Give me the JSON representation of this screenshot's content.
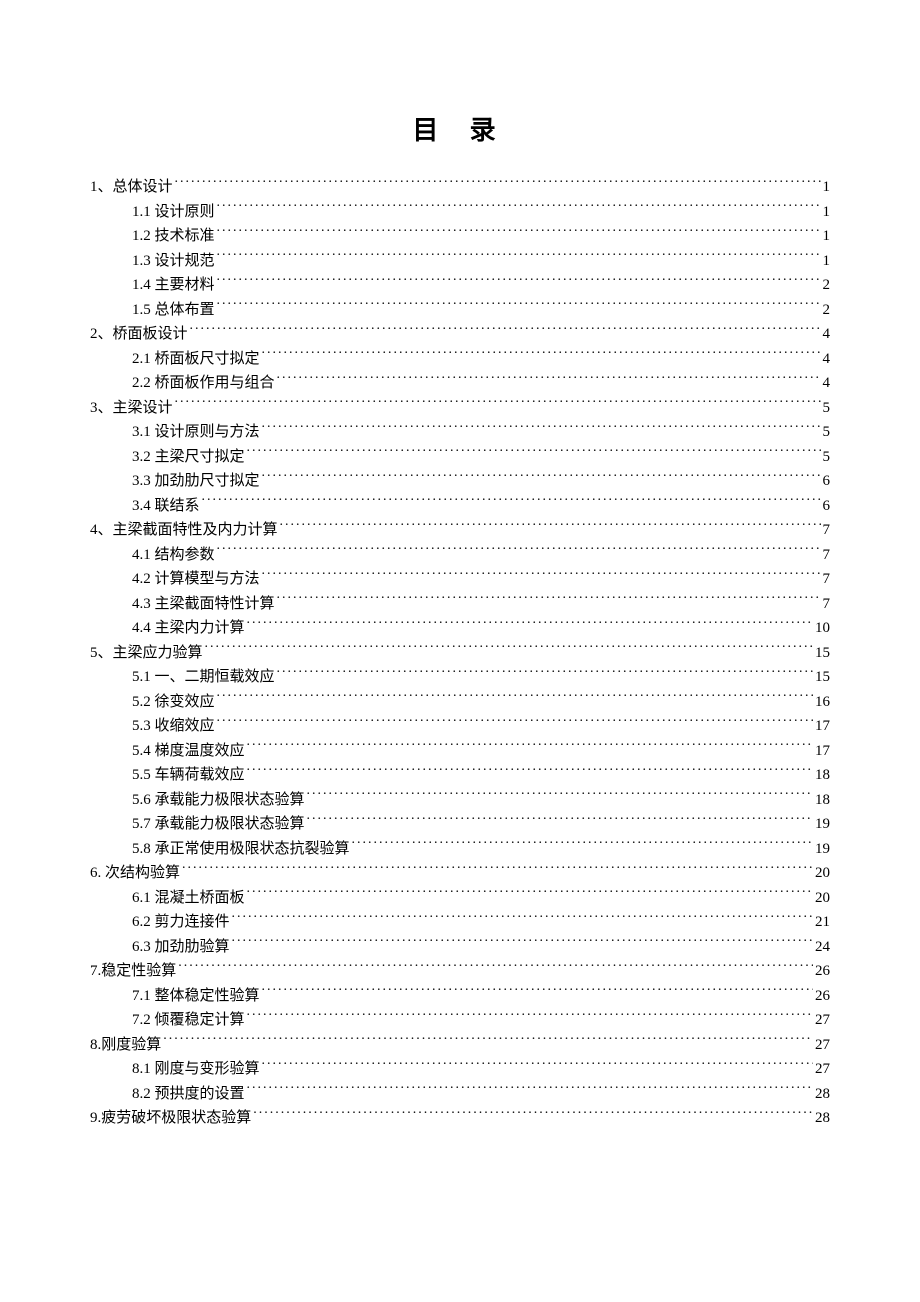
{
  "title": "目 录",
  "toc": [
    {
      "level": 1,
      "label": "1、总体设计",
      "page": "1"
    },
    {
      "level": 2,
      "label": "1.1 设计原则",
      "page": "1"
    },
    {
      "level": 2,
      "label": "1.2 技术标准",
      "page": "1"
    },
    {
      "level": 2,
      "label": "1.3  设计规范",
      "page": "1"
    },
    {
      "level": 2,
      "label": "1.4 主要材料",
      "page": "2"
    },
    {
      "level": 2,
      "label": "1.5 总体布置",
      "page": "2"
    },
    {
      "level": 1,
      "label": "2、桥面板设计",
      "page": "4"
    },
    {
      "level": 2,
      "label": "2.1 桥面板尺寸拟定",
      "page": "4"
    },
    {
      "level": 2,
      "label": "2.2 桥面板作用与组合",
      "page": "4"
    },
    {
      "level": 1,
      "label": "3、主梁设计",
      "page": "5"
    },
    {
      "level": 2,
      "label": "3.1 设计原则与方法",
      "page": "5"
    },
    {
      "level": 2,
      "label": "3.2 主梁尺寸拟定",
      "page": "5"
    },
    {
      "level": 2,
      "label": "3.3 加劲肋尺寸拟定",
      "page": "6"
    },
    {
      "level": 2,
      "label": "3.4 联结系",
      "page": "6"
    },
    {
      "level": 1,
      "label": "4、主梁截面特性及内力计算",
      "page": "7"
    },
    {
      "level": 2,
      "label": "4.1 结构参数",
      "page": "7"
    },
    {
      "level": 2,
      "label": "4.2 计算模型与方法",
      "page": "7"
    },
    {
      "level": 2,
      "label": "4.3 主梁截面特性计算",
      "page": "7"
    },
    {
      "level": 2,
      "label": "4.4 主梁内力计算",
      "page": "10"
    },
    {
      "level": 1,
      "label": "5、主梁应力验算",
      "page": "15"
    },
    {
      "level": 2,
      "label": "5.1 一、二期恒载效应",
      "page": "15"
    },
    {
      "level": 2,
      "label": "5.2 徐变效应",
      "page": "16"
    },
    {
      "level": 2,
      "label": "5.3 收缩效应",
      "page": "17"
    },
    {
      "level": 2,
      "label": "5.4 梯度温度效应",
      "page": "17"
    },
    {
      "level": 2,
      "label": "5.5 车辆荷载效应",
      "page": "18"
    },
    {
      "level": 2,
      "label": "5.6 承载能力极限状态验算",
      "page": "18"
    },
    {
      "level": 2,
      "label": "5.7 承载能力极限状态验算",
      "page": "19"
    },
    {
      "level": 2,
      "label": "5.8 承正常使用极限状态抗裂验算",
      "page": "19"
    },
    {
      "level": 1,
      "label": "6.  次结构验算",
      "page": "20"
    },
    {
      "level": 2,
      "label": "6.1 混凝土桥面板",
      "page": "20"
    },
    {
      "level": 2,
      "label": "6.2 剪力连接件",
      "page": "21"
    },
    {
      "level": 2,
      "label": "6.3 加劲肋验算",
      "page": "24"
    },
    {
      "level": 1,
      "label": "7.稳定性验算",
      "page": "26"
    },
    {
      "level": 2,
      "label": "7.1 整体稳定性验算",
      "page": "26"
    },
    {
      "level": 2,
      "label": "7.2 倾覆稳定计算",
      "page": "27"
    },
    {
      "level": 1,
      "label": "8.刚度验算",
      "page": "27"
    },
    {
      "level": 2,
      "label": "8.1 刚度与变形验算",
      "page": "27"
    },
    {
      "level": 2,
      "label": "8.2 预拱度的设置",
      "page": "28"
    },
    {
      "level": 1,
      "label": "9.疲劳破坏极限状态验算",
      "page": "28"
    }
  ]
}
